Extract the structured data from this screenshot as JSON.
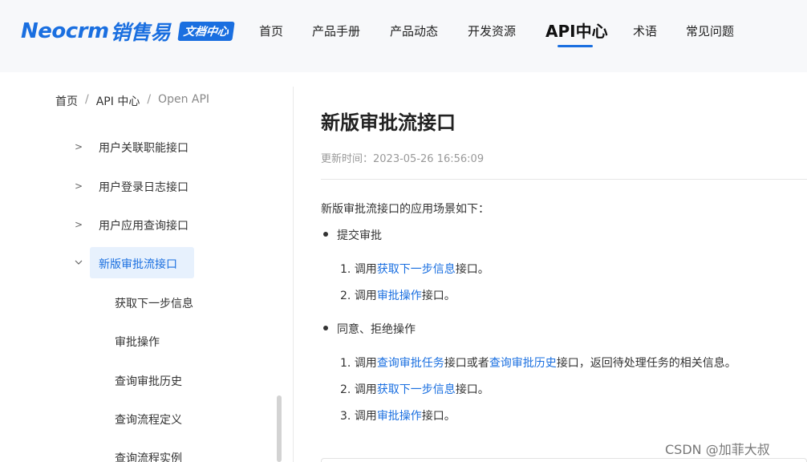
{
  "brand": {
    "logo_word": "Neocrm",
    "logo_cn": "销售易",
    "badge": "文档中心"
  },
  "nav": {
    "items": [
      "首页",
      "产品手册",
      "产品动态",
      "开发资源",
      "API中心",
      "术语",
      "常见问题"
    ],
    "active_index": 4
  },
  "breadcrumb": [
    "首页",
    "API 中心",
    "Open API"
  ],
  "sidebar": {
    "items": [
      {
        "label": "用户关联职能接口",
        "arrow": "chevron-right"
      },
      {
        "label": "用户登录日志接口",
        "arrow": "chevron-right"
      },
      {
        "label": "用户应用查询接口",
        "arrow": "chevron-right"
      },
      {
        "label": "新版审批流接口",
        "arrow": "chevron-down",
        "active": true
      }
    ],
    "children": [
      "获取下一步信息",
      "审批操作",
      "查询审批历史",
      "查询流程定义",
      "查询流程实例"
    ]
  },
  "article": {
    "title": "新版审批流接口",
    "updated_label": "更新时间：",
    "updated_value": "2023-05-26 16:56:09",
    "intro": "新版审批流接口的应用场景如下：",
    "section1": {
      "heading": "提交审批",
      "steps": [
        {
          "num": "1.",
          "pre": "调用",
          "link": "获取下一步信息",
          "post": "接口。"
        },
        {
          "num": "2.",
          "pre": "调用",
          "link": "审批操作",
          "post": "接口。"
        }
      ]
    },
    "section2": {
      "heading": "同意、拒绝操作",
      "step1": {
        "num": "1.",
        "pre": "调用",
        "link1": "查询审批任务",
        "mid": "接口或者",
        "link2": "查询审批历史",
        "post": "接口，返回待处理任务的相关信息。"
      },
      "step2": {
        "num": "2.",
        "pre": "调用",
        "link": "获取下一步信息",
        "post": "接口。"
      },
      "step3": {
        "num": "3.",
        "pre": "调用",
        "link": "审批操作",
        "post": "接口。"
      }
    }
  },
  "watermark": "CSDN @加菲大叔",
  "colors": {
    "accent": "#1a6fe0",
    "active_bg": "#e7f1fd",
    "header_bg": "#f7f8fa"
  }
}
